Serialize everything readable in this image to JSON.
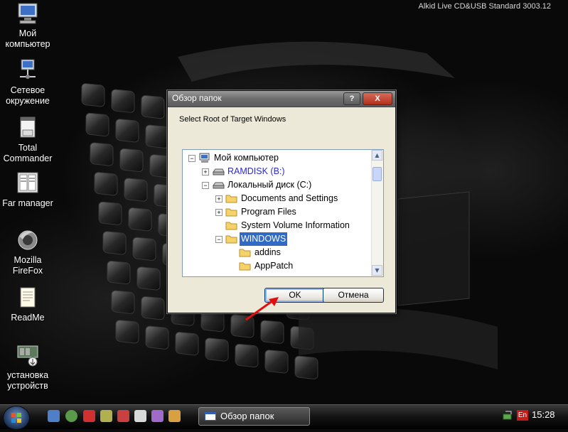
{
  "desktop": {
    "corner_text": "Alkid Live CD&USB Standard 3003.12",
    "icons": [
      {
        "label": "Мой\nкомпьютер",
        "icon": "my-computer-icon"
      },
      {
        "label": "Сетевое\nокружение",
        "icon": "network-icon"
      },
      {
        "label": "Total\nCommander",
        "icon": "total-commander-icon"
      },
      {
        "label": "Far manager",
        "icon": "far-manager-icon"
      },
      {
        "label": "Mozilla\nFireFox",
        "icon": "firefox-icon"
      },
      {
        "label": "ReadMe",
        "icon": "readme-icon"
      },
      {
        "label": "установка\nустройств",
        "icon": "device-install-icon"
      }
    ]
  },
  "dialog": {
    "title": "Обзор папок",
    "help_label": "?",
    "close_label": "X",
    "caption": "Select Root of Target Windows",
    "tree": [
      {
        "label": "Мой компьютер",
        "expander": "−",
        "icon": "computer-icon",
        "type": "normal"
      },
      {
        "label": "RAMDISK (B:)",
        "expander": "+",
        "icon": "drive-icon",
        "type": "drive"
      },
      {
        "label": "Локальный диск (C:)",
        "expander": "−",
        "icon": "drive-icon",
        "type": "normal"
      },
      {
        "label": "Documents and Settings",
        "expander": "+",
        "icon": "folder-icon",
        "type": "normal"
      },
      {
        "label": "Program Files",
        "expander": "+",
        "icon": "folder-icon",
        "type": "normal"
      },
      {
        "label": "System Volume Information",
        "expander": "",
        "icon": "folder-icon",
        "type": "normal"
      },
      {
        "label": "WINDOWS",
        "expander": "−",
        "icon": "folder-icon",
        "type": "selected"
      },
      {
        "label": "addins",
        "expander": "",
        "icon": "folder-icon",
        "type": "normal"
      },
      {
        "label": "AppPatch",
        "expander": "",
        "icon": "folder-icon",
        "type": "normal"
      }
    ],
    "ok_label": "OK",
    "cancel_label": "Отмена"
  },
  "taskbar": {
    "task_label": "Обзор папок",
    "lang": "En",
    "clock": "15:28"
  },
  "colors": {
    "selection": "#316ac5",
    "arrow": "#e01010",
    "drive_text": "#2a2ad0"
  }
}
